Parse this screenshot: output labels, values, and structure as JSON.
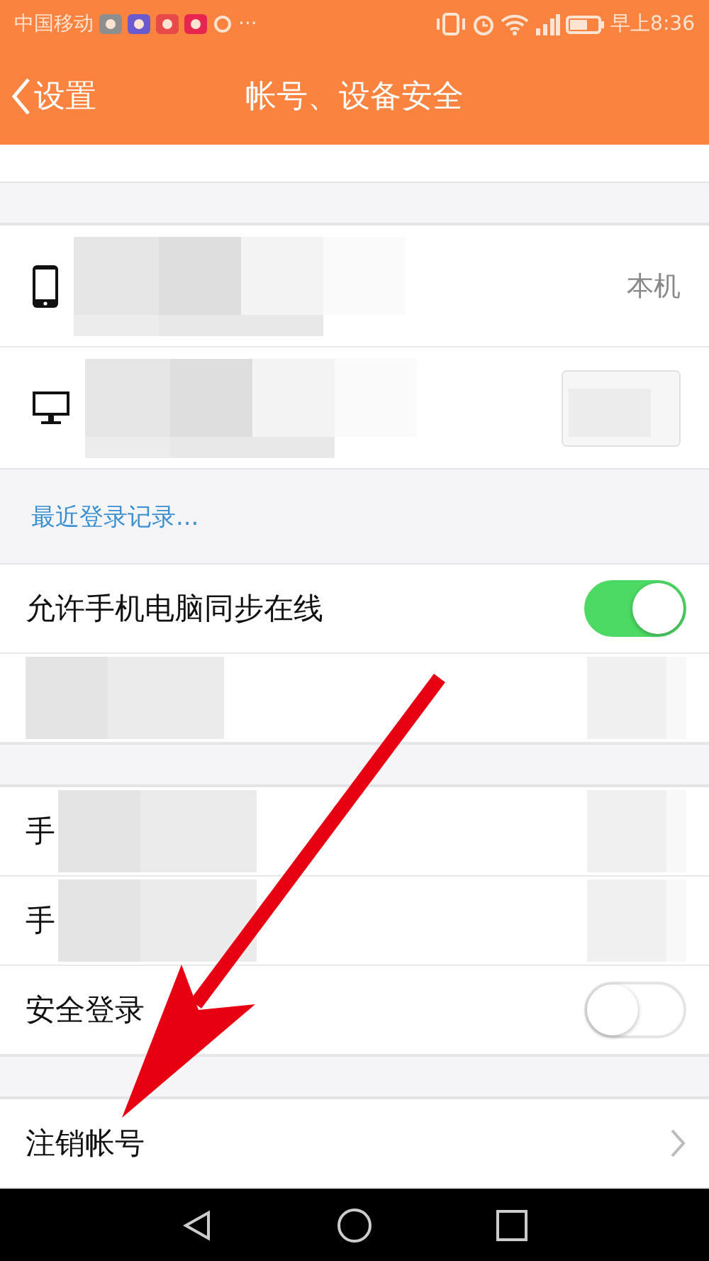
{
  "status_bar": {
    "carrier": "中国移动",
    "more": "···",
    "time": "早上8:36"
  },
  "header": {
    "back_label": "设置",
    "title": "帐号、设备安全"
  },
  "devices": [
    {
      "kind": "phone",
      "note": "本机"
    },
    {
      "kind": "desktop"
    }
  ],
  "recent_login_link": "最近登录记录...",
  "groups": [
    [
      {
        "kind": "toggle",
        "label": "允许手机电脑同步在线",
        "on": true
      },
      {
        "kind": "redacted"
      }
    ],
    [
      {
        "kind": "redacted",
        "label": "手"
      },
      {
        "kind": "redacted",
        "label": "手"
      },
      {
        "kind": "toggle",
        "label": "安全登录",
        "on": false
      }
    ],
    [
      {
        "kind": "link",
        "label": "注销帐号"
      }
    ]
  ]
}
